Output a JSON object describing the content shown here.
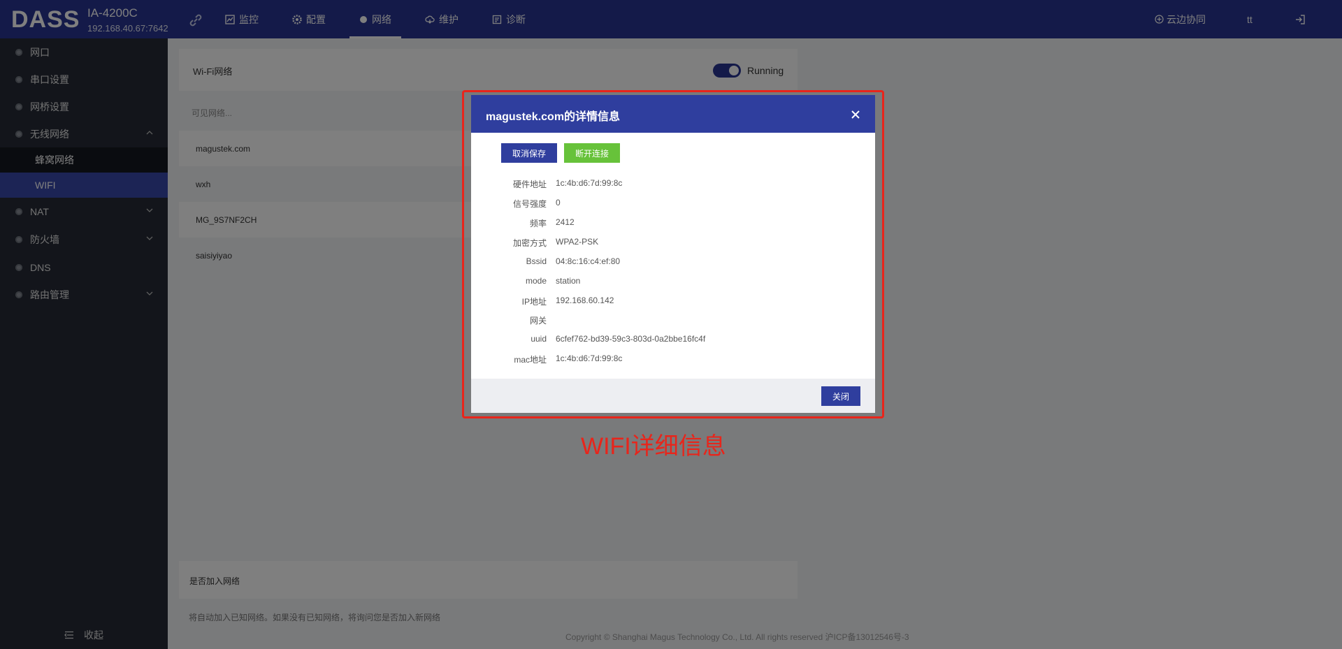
{
  "header": {
    "logo": "DASS",
    "device_model": "IA-4200C",
    "device_ip": "192.168.40.67:7642",
    "nav": [
      {
        "label": "监控",
        "icon": "chart-icon"
      },
      {
        "label": "配置",
        "icon": "gear-icon"
      },
      {
        "label": "网络",
        "icon": "dot-icon",
        "active": true
      },
      {
        "label": "维护",
        "icon": "cloud-icon"
      },
      {
        "label": "诊断",
        "icon": "document-icon"
      }
    ],
    "cloud_label": "云边协同",
    "user": "tt"
  },
  "sidebar": {
    "items": [
      {
        "label": "网口"
      },
      {
        "label": "串口设置"
      },
      {
        "label": "网桥设置"
      },
      {
        "label": "无线网络",
        "expanded": true
      },
      {
        "label": "NAT"
      },
      {
        "label": "防火墙"
      },
      {
        "label": "DNS"
      },
      {
        "label": "路由管理"
      }
    ],
    "sub_items": [
      {
        "label": "蜂窝网络"
      },
      {
        "label": "WIFI",
        "active": true
      }
    ],
    "collapse_label": "收起"
  },
  "main": {
    "wifi_title": "Wi-Fi网络",
    "status": "Running",
    "visible_label": "可见网络...",
    "networks": [
      "magustek.com",
      "wxh",
      "MG_9S7NF2CH",
      "saisiyiyao"
    ],
    "join_title": "是否加入网络",
    "hint": "将自动加入已知网络。如果没有已知网络，将询问您是否加入新网络",
    "footer": "Copyright © Shanghai Magus Technology Co., Ltd. All rights reserved     沪ICP备13012546号-3"
  },
  "modal": {
    "title": "magustek.com的详情信息",
    "unsave_label": "取消保存",
    "disconnect_label": "断开连接",
    "rows": [
      {
        "key": "硬件地址",
        "value": "1c:4b:d6:7d:99:8c"
      },
      {
        "key": "信号强度",
        "value": "0"
      },
      {
        "key": "频率",
        "value": "2412"
      },
      {
        "key": "加密方式",
        "value": "WPA2-PSK"
      },
      {
        "key": "Bssid",
        "value": "04:8c:16:c4:ef:80"
      },
      {
        "key": "mode",
        "value": "station"
      },
      {
        "key": "IP地址",
        "value": "192.168.60.142"
      },
      {
        "key": "网关",
        "value": ""
      },
      {
        "key": "uuid",
        "value": "6cfef762-bd39-59c3-803d-0a2bbe16fc4f"
      },
      {
        "key": "mac地址",
        "value": "1c:4b:d6:7d:99:8c"
      }
    ],
    "close_label": "关闭"
  },
  "annotation": {
    "text": "WIFI详细信息",
    "color": "#e8251b"
  },
  "colors": {
    "primary": "#283593",
    "success": "#67c23a",
    "sidebar_bg": "#262b36"
  }
}
